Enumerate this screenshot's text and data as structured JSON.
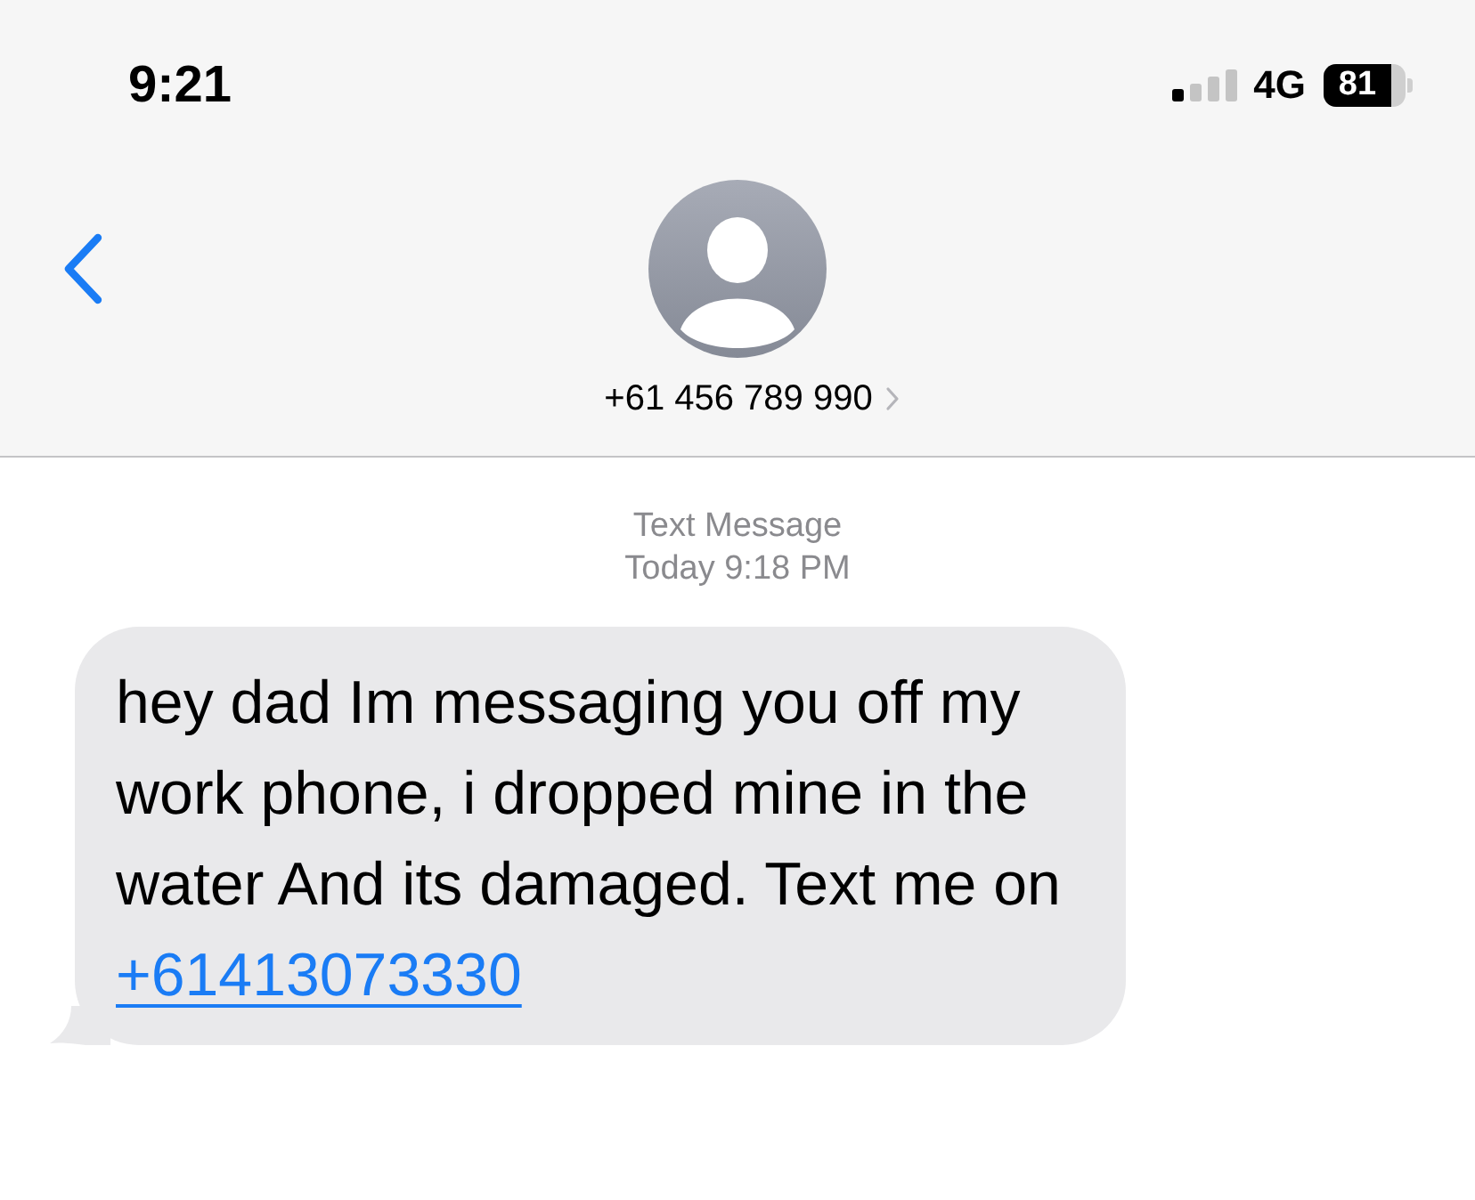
{
  "status_bar": {
    "time": "9:21",
    "network": "4G",
    "battery": "81"
  },
  "nav": {
    "contact": "+61 456 789 990"
  },
  "thread": {
    "service": "Text Message",
    "timestamp": "Today 9:18 PM",
    "messages": [
      {
        "kind": "incoming",
        "text": "hey dad Im messaging you off my work phone, i dropped mine in the water And its damaged. Text me on",
        "link": "+61413073330"
      }
    ]
  }
}
